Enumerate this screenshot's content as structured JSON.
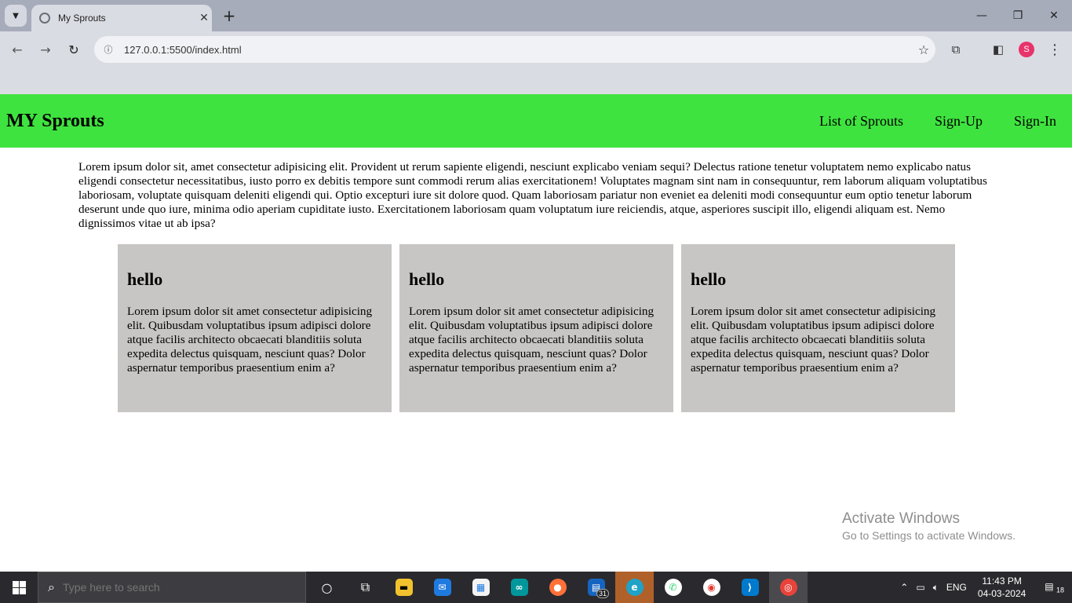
{
  "browser": {
    "tab_title": "My Sprouts",
    "tab_close": "✕",
    "new_tab": "+",
    "url": "127.0.0.1:5500/index.html",
    "window": {
      "minimize": "—",
      "maximize": "❐",
      "close": "✕"
    }
  },
  "site": {
    "brand": "MY Sprouts",
    "nav": [
      {
        "label": "List of Sprouts"
      },
      {
        "label": "Sign-Up"
      },
      {
        "label": "Sign-In"
      }
    ],
    "intro": "Lorem ipsum dolor sit, amet consectetur adipisicing elit. Provident ut rerum sapiente eligendi, nesciunt explicabo veniam sequi? Delectus ratione tenetur voluptatem nemo explicabo natus eligendi consectetur necessitatibus, iusto porro ex debitis tempore sunt commodi rerum alias exercitationem! Voluptates magnam sint nam in consequuntur, rem laborum aliquam voluptatibus laboriosam, voluptate quisquam deleniti eligendi qui. Optio excepturi iure sit dolore quod. Quam laboriosam pariatur non eveniet ea deleniti modi consequuntur eum optio tenetur laborum deserunt unde quo iure, minima odio aperiam cupiditate iusto. Exercitationem laboriosam quam voluptatum iure reiciendis, atque, asperiores suscipit illo, eligendi aliquam est. Nemo dignissimos vitae ut ab ipsa?",
    "cards": [
      {
        "heading": "hello",
        "body": "Lorem ipsum dolor sit amet consectetur adipisicing elit. Quibusdam voluptatibus ipsum adipisci dolore atque facilis architecto obcaecati blanditiis soluta expedita delectus quisquam, nesciunt quas? Dolor aspernatur temporibus praesentium enim a?"
      },
      {
        "heading": "hello",
        "body": "Lorem ipsum dolor sit amet consectetur adipisicing elit. Quibusdam voluptatibus ipsum adipisci dolore atque facilis architecto obcaecati blanditiis soluta expedita delectus quisquam, nesciunt quas? Dolor aspernatur temporibus praesentium enim a?"
      },
      {
        "heading": "hello",
        "body": "Lorem ipsum dolor sit amet consectetur adipisicing elit. Quibusdam voluptatibus ipsum adipisci dolore atque facilis architecto obcaecati blanditiis soluta expedita delectus quisquam, nesciunt quas? Dolor aspernatur temporibus praesentium enim a?"
      }
    ],
    "header_color": "#3fe33f",
    "card_color": "#c8c6c4"
  },
  "watermark": {
    "line1": "Activate Windows",
    "line2": "Go to Settings to activate Windows."
  },
  "taskbar": {
    "search_placeholder": "Type here to search",
    "mail_badge": "31",
    "language": "ENG",
    "time": "11:43 PM",
    "date": "04-03-2024",
    "notification_count": "18"
  },
  "profile_initial": "S"
}
